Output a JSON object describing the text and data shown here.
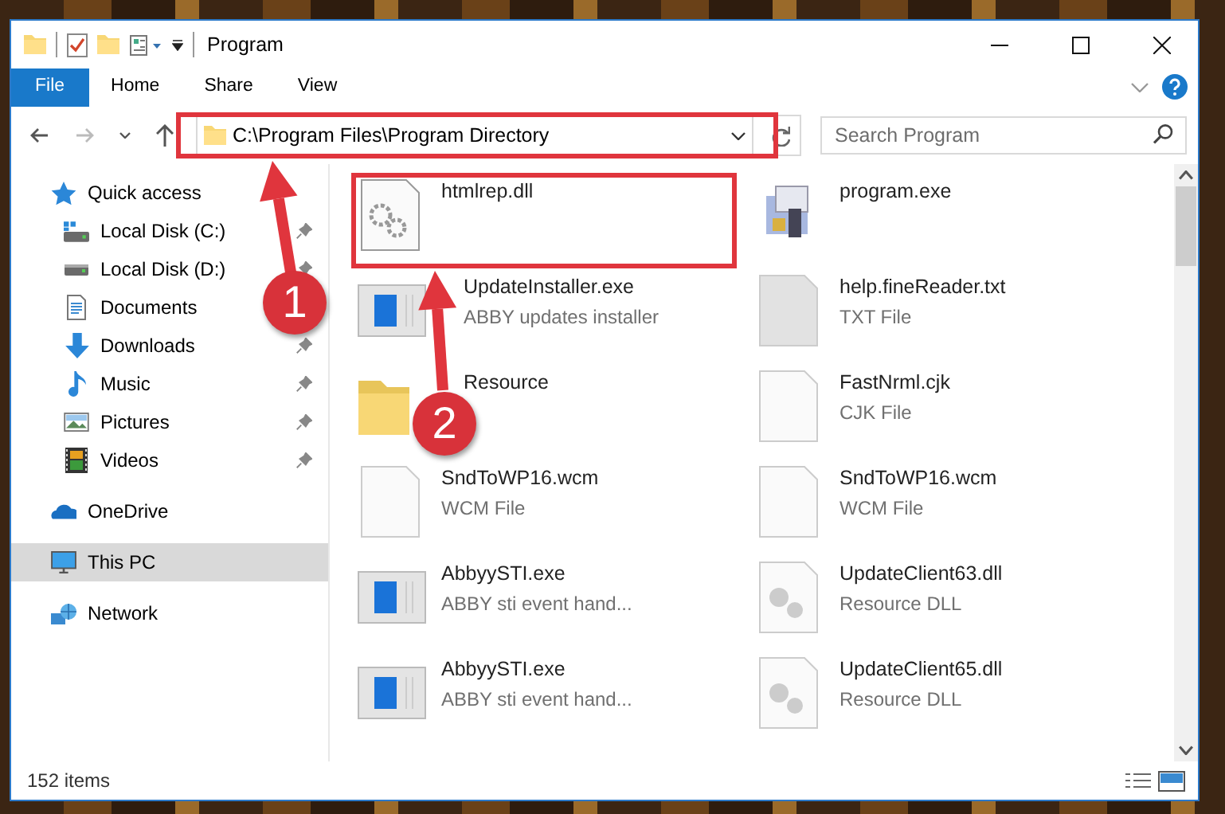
{
  "window": {
    "title": "Program"
  },
  "ribbon": {
    "tabs": [
      {
        "label": "File",
        "kind": "file"
      },
      {
        "label": "Home",
        "kind": "tab"
      },
      {
        "label": "Share",
        "kind": "tab"
      },
      {
        "label": "View",
        "kind": "tab"
      }
    ]
  },
  "address_bar": {
    "path": "C:\\Program Files\\Program Directory"
  },
  "search": {
    "placeholder": "Search Program"
  },
  "navigation": [
    {
      "label": "Quick access",
      "kind": "quick-access",
      "pinned": false,
      "selected": false,
      "children": [
        {
          "label": "Local Disk (C:)",
          "kind": "drive-c",
          "pinned": true,
          "selected": false
        },
        {
          "label": "Local Disk (D:)",
          "kind": "drive",
          "pinned": true,
          "selected": false
        },
        {
          "label": "Documents",
          "kind": "documents",
          "selected": false
        },
        {
          "label": "Downloads",
          "kind": "downloads",
          "pinned": true,
          "selected": false
        },
        {
          "label": "Music",
          "kind": "music",
          "pinned": true,
          "selected": false
        },
        {
          "label": "Pictures",
          "kind": "pictures",
          "pinned": true,
          "selected": false
        },
        {
          "label": "Videos",
          "kind": "videos",
          "pinned": true,
          "selected": false
        }
      ]
    },
    {
      "label": "OneDrive",
      "kind": "onedrive",
      "pinned": false,
      "selected": false
    },
    {
      "label": "This PC",
      "kind": "pc",
      "pinned": false,
      "selected": true
    },
    {
      "label": "Network",
      "kind": "network",
      "pinned": false,
      "selected": false
    }
  ],
  "files": [
    {
      "name": "htmlrep.dll",
      "kind": "gear-file"
    },
    {
      "name": "program.exe",
      "kind": "program"
    },
    {
      "name": "UpdateInstaller.exe",
      "type": "ABBY updates installer",
      "kind": "app"
    },
    {
      "name": "help.fineReader.txt",
      "type": "TXT File",
      "kind": "text-file"
    },
    {
      "name": "Resource",
      "kind": "folder"
    },
    {
      "name": "FastNrml.cjk",
      "type": "CJK File",
      "kind": "blank"
    },
    {
      "name": "SndToWP16.wcm",
      "type": "WCM File",
      "kind": "blank"
    },
    {
      "name": "SndToWP16.wcm",
      "type": "WCM File",
      "kind": "blank"
    },
    {
      "name": "AbbyySTI.exe",
      "type": "ABBY sti event hand...",
      "kind": "app"
    },
    {
      "name": "UpdateClient63.dll",
      "type": "Resource DLL",
      "kind": "key-file"
    },
    {
      "name": "AbbyySTI.exe",
      "type": "ABBY sti event hand...",
      "kind": "app"
    },
    {
      "name": "UpdateClient65.dll",
      "type": "Resource DLL",
      "kind": "key-file"
    }
  ],
  "status_bar": {
    "item_count": "152 items"
  },
  "callouts": [
    {
      "number": "1"
    },
    {
      "number": "2"
    }
  ]
}
